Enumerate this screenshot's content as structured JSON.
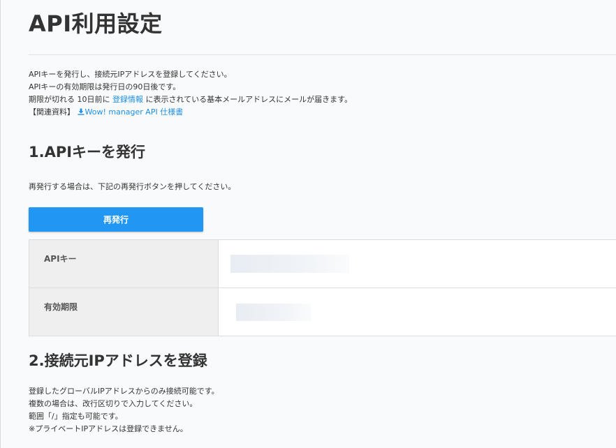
{
  "page": {
    "title": "API利用設定"
  },
  "intro": {
    "line1": "APIキーを発行し、接続元IPアドレスを登録してください。",
    "line2": "APIキーの有効期限は発行日の90日後です。",
    "line3_before": "期限が切れる 10日前に ",
    "line3_link": "登録情報",
    "line3_after": " に表示されている基本メールアドレスにメールが届きます。",
    "related_label": "【関連資料】",
    "related_link": "Wow! manager API 仕様書"
  },
  "section1": {
    "heading": "1.APIキーを発行",
    "note": "再発行する場合は、下記の再発行ボタンを押してください。",
    "reissue_button": "再発行",
    "rows": [
      {
        "label": "APIキー",
        "value": ""
      },
      {
        "label": "有効期限",
        "value": ""
      }
    ]
  },
  "section2": {
    "heading": "2.接続元IPアドレスを登録",
    "notes": [
      "登録したグローバルIPアドレスからのみ接続可能です。",
      "複数の場合は、改行区切りで入力してください。",
      "範囲「/」指定も可能です。",
      "※プライベートIPアドレスは登録できません。"
    ]
  },
  "colors": {
    "accent": "#2196f3",
    "link": "#1d8fe1",
    "text": "#333333",
    "table_header_bg": "#efefef",
    "page_bg": "#f9fafb"
  },
  "icons": {
    "download": "download-icon"
  }
}
